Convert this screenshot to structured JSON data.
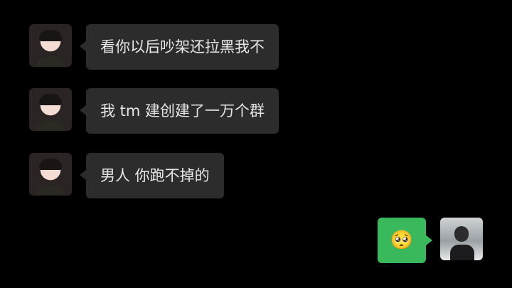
{
  "messages": [
    {
      "side": "left",
      "sender": "her",
      "text": "看你以后吵架还拉黑我不"
    },
    {
      "side": "left",
      "sender": "her",
      "text": "我 tm 建创建了一万个群"
    },
    {
      "side": "left",
      "sender": "her",
      "text": "男人 你跑不掉的"
    },
    {
      "side": "right",
      "sender": "me",
      "emoji": "🥺"
    }
  ],
  "colors": {
    "background": "#000000",
    "incoming_bubble": "#2c2c2c",
    "outgoing_bubble": "#39b85c",
    "text": "#e7e7e7"
  }
}
